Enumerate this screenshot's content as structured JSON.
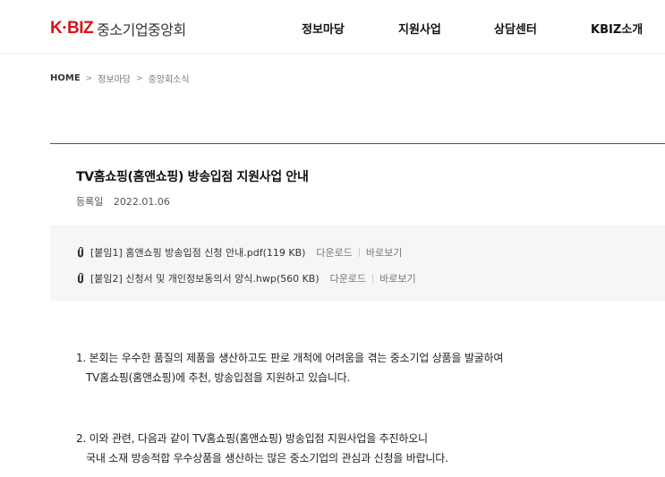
{
  "header": {
    "logo_mark": "K·BIZ",
    "logo_text": "중소기업중앙회",
    "nav": [
      {
        "label": "정보마당"
      },
      {
        "label": "지원사업"
      },
      {
        "label": "상담센터"
      },
      {
        "label": "KBIZ소개"
      }
    ]
  },
  "breadcrumb": {
    "home": "HOME",
    "separator": ">",
    "items": [
      "정보마당",
      "중앙회소식"
    ]
  },
  "post": {
    "title": "TV홈쇼핑(홈앤쇼핑) 방송입점 지원사업 안내",
    "date_label": "등록일",
    "date_value": "2022.01.06",
    "attachments": [
      {
        "name": "[붙임1] 홈앤쇼핑 방송입점 신청 안내.pdf(119 KB)",
        "download": "다운로드",
        "view": "바로보기"
      },
      {
        "name": "[붙임2] 신청서 및 개인정보동의서 양식.hwp(560 KB)",
        "download": "다운로드",
        "view": "바로보기"
      }
    ],
    "paragraphs": [
      {
        "line1": "1. 본회는 우수한 품질의 제품을 생산하고도 판로 개척에 어려움을 겪는 중소기업 상품을 발굴하여",
        "line2": "TV홈쇼핑(홈앤쇼핑)에 추천, 방송입점을 지원하고 있습니다."
      },
      {
        "line1": "2. 이와 관련, 다음과 같이 TV홈쇼핑(홈앤쇼핑) 방송입점 지원사업을 추진하오니",
        "line2": "국내 소재 방송적합 우수상품을 생산하는 많은 중소기업의 관심과 신청을 바랍니다."
      }
    ]
  },
  "colors": {
    "brand": "#d7141a",
    "attachment_bg": "#f6f6f6",
    "divider": "#555555"
  },
  "icons": {
    "attachment": "paperclip-icon"
  }
}
